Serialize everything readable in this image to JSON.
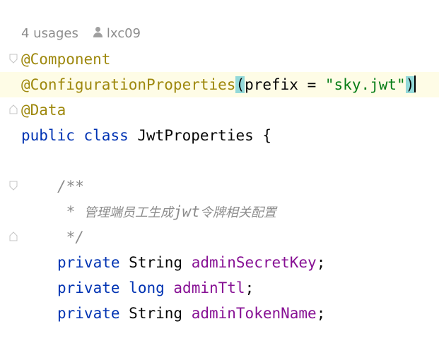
{
  "inlay": {
    "usages": "4 usages",
    "author": "lxc09"
  },
  "code": {
    "line1": {
      "annotation": "@Component"
    },
    "line2": {
      "annotation": "@ConfigurationProperties",
      "open_paren": "(",
      "param": "prefix = ",
      "string": "\"sky.jwt\"",
      "close_paren": ")"
    },
    "line3": {
      "annotation": "@Data"
    },
    "line4": {
      "kw_public": "public",
      "kw_class": "class",
      "class_name": "JwtProperties {"
    },
    "line6": {
      "comment": "/**"
    },
    "line7": {
      "comment_star": " * ",
      "comment_text_a": "管理端员工生成",
      "comment_jwt": "jwt",
      "comment_text_b": "令牌相关配置"
    },
    "line8": {
      "comment": " */"
    },
    "line9": {
      "kw": "private",
      "type": "String",
      "field": "adminSecretKey",
      "end": ";"
    },
    "line10": {
      "kw": "private",
      "type": "long",
      "field": "adminTtl",
      "end": ";"
    },
    "line11": {
      "kw": "private",
      "type": "String",
      "field": "adminTokenName",
      "end": ";"
    }
  },
  "colors": {
    "annotation": "#9e880d",
    "keyword": "#0033b3",
    "string": "#067d17",
    "field": "#871094",
    "comment": "#8c8c8c",
    "current_line_bg": "#fefce6",
    "brace_match_bg": "#93d9d9"
  }
}
